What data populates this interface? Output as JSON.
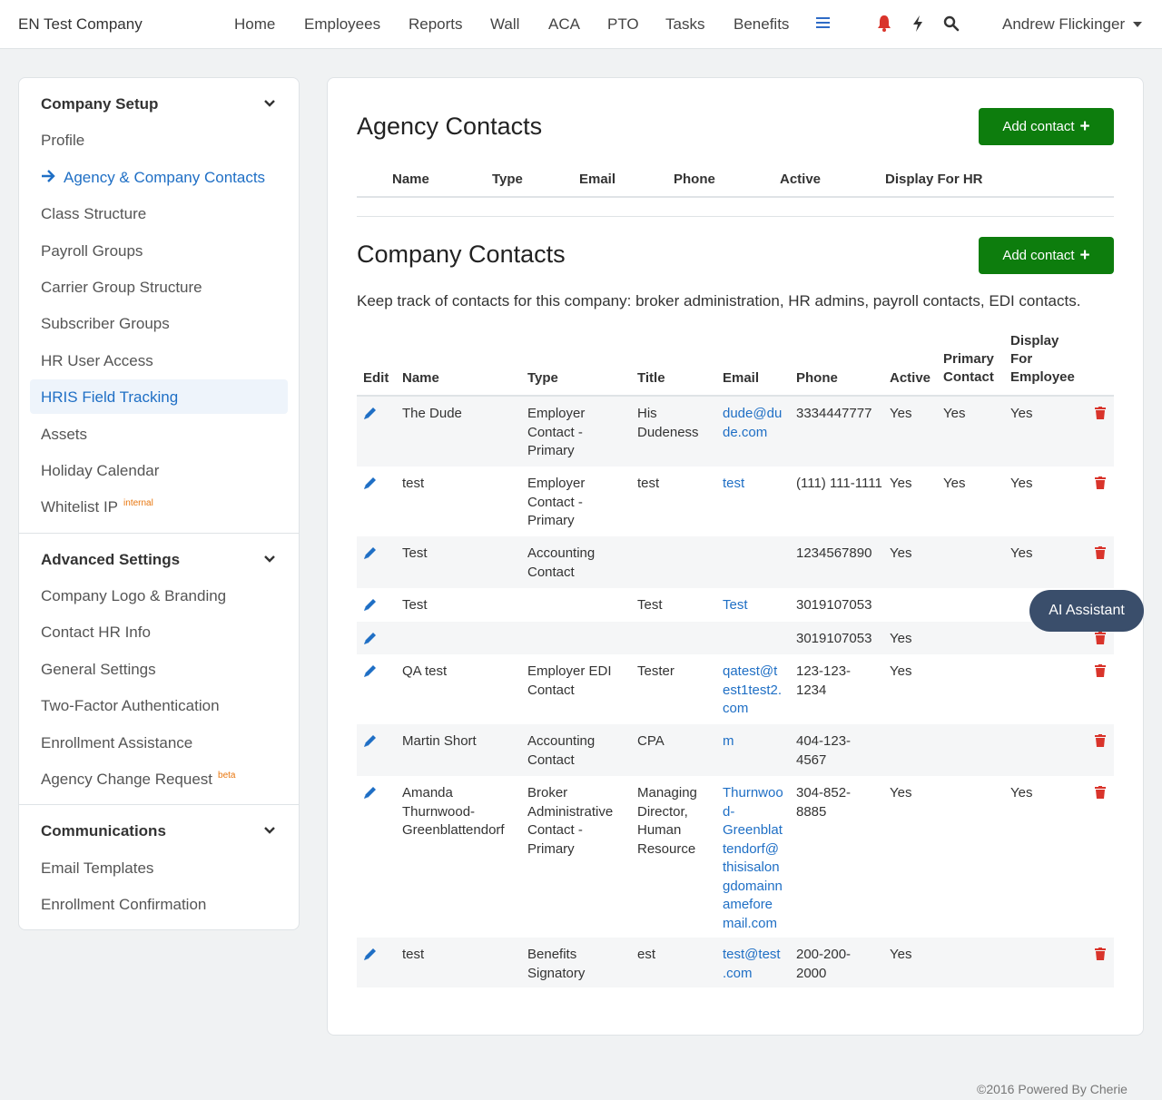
{
  "topnav": {
    "brand": "EN Test Company",
    "links": [
      "Home",
      "Employees",
      "Reports",
      "Wall",
      "ACA",
      "PTO",
      "Tasks",
      "Benefits"
    ],
    "user": "Andrew Flickinger"
  },
  "sidebar": {
    "company_setup": "Company Setup",
    "company_items": [
      "Profile",
      "Agency & Company Contacts",
      "Class Structure",
      "Payroll Groups",
      "Carrier Group Structure",
      "Subscriber Groups",
      "HR User Access",
      "HRIS Field Tracking",
      "Assets",
      "Holiday Calendar",
      "Whitelist IP"
    ],
    "internal_tag": "internal",
    "advanced_settings": "Advanced Settings",
    "advanced_items": [
      "Company Logo & Branding",
      "Contact HR Info",
      "General Settings",
      "Two-Factor Authentication",
      "Enrollment Assistance",
      "Agency Change Request"
    ],
    "beta_tag": "beta",
    "communications": "Communications",
    "comm_items": [
      "Email Templates",
      "Enrollment Confirmation"
    ]
  },
  "agency": {
    "title": "Agency Contacts",
    "add_label": "Add contact",
    "headers": [
      "Name",
      "Type",
      "Email",
      "Phone",
      "Active",
      "Display For HR"
    ]
  },
  "company": {
    "title": "Company Contacts",
    "add_label": "Add contact",
    "description": "Keep track of contacts for this company: broker administration, HR admins, payroll contacts, EDI contacts.",
    "headers": {
      "edit": "Edit",
      "name": "Name",
      "type": "Type",
      "title": "Title",
      "email": "Email",
      "phone": "Phone",
      "active": "Active",
      "primary": [
        "Primary",
        "Contact"
      ],
      "display": [
        "Display",
        "For",
        "Employee"
      ]
    },
    "rows": [
      {
        "name": [
          "The Dude"
        ],
        "type": [
          "Employer",
          "Contact -",
          "Primary"
        ],
        "title": [
          "His",
          "Dudeness"
        ],
        "email": [
          "dude@du",
          "de.com"
        ],
        "phone": [
          "3334447777"
        ],
        "active": "Yes",
        "primary": "Yes",
        "display": "Yes"
      },
      {
        "name": [
          "test"
        ],
        "type": [
          "Employer",
          "Contact -",
          "Primary"
        ],
        "title": [
          "test"
        ],
        "email": [
          "test"
        ],
        "phone": [
          "(111) 111-1111"
        ],
        "active": "Yes",
        "primary": "Yes",
        "display": "Yes"
      },
      {
        "name": [
          "Test"
        ],
        "type": [
          "Accounting",
          "Contact"
        ],
        "title": [],
        "email": [],
        "phone": [
          "1234567890"
        ],
        "active": "Yes",
        "primary": "",
        "display": "Yes"
      },
      {
        "name": [
          "Test"
        ],
        "type": [],
        "title": [
          "Test"
        ],
        "email": [
          "Test"
        ],
        "phone": [
          "3019107053"
        ],
        "active": "",
        "primary": "",
        "display": ""
      },
      {
        "name": [],
        "type": [],
        "title": [],
        "email": [],
        "phone": [
          "3019107053"
        ],
        "active": "Yes",
        "primary": "",
        "display": ""
      },
      {
        "name": [
          "QA test"
        ],
        "type": [
          "Employer EDI",
          "Contact"
        ],
        "title": [
          "Tester"
        ],
        "email": [
          "qatest@t",
          "est1test2.",
          "com"
        ],
        "phone": [
          "123-123-",
          "1234"
        ],
        "active": "Yes",
        "primary": "",
        "display": ""
      },
      {
        "name": [
          "Martin Short"
        ],
        "type": [
          "Accounting",
          "Contact"
        ],
        "title": [
          "CPA"
        ],
        "email": [
          "m"
        ],
        "phone": [
          "404-123-",
          "4567"
        ],
        "active": "",
        "primary": "",
        "display": ""
      },
      {
        "name": [
          "Amanda",
          "Thurnwood-",
          "Greenblattendorf"
        ],
        "type": [
          "Broker",
          "Administrative",
          "Contact -",
          "Primary"
        ],
        "title": [
          "Managing",
          "Director,",
          "Human",
          "Resource"
        ],
        "email": [
          "Thurnwoo",
          "d-",
          "Greenblat",
          "tendorf@",
          "thisisalon",
          "gdomainn",
          "amefore",
          "mail.com"
        ],
        "phone": [
          "304-852-",
          "8885"
        ],
        "active": "Yes",
        "primary": "",
        "display": "Yes"
      },
      {
        "name": [
          "test"
        ],
        "type": [
          "Benefits",
          "Signatory"
        ],
        "title": [
          "est"
        ],
        "email": [
          "test@test",
          ".com"
        ],
        "phone": [
          "200-200-",
          "2000"
        ],
        "active": "Yes",
        "primary": "",
        "display": ""
      }
    ]
  },
  "ai_assistant": "AI Assistant",
  "footer": "©2016 Powered By Cherie",
  "colors": {
    "accent": "#1f6fc5",
    "button": "#0d7d0d",
    "danger": "#d9342b",
    "ai": "#3a4e6b"
  }
}
